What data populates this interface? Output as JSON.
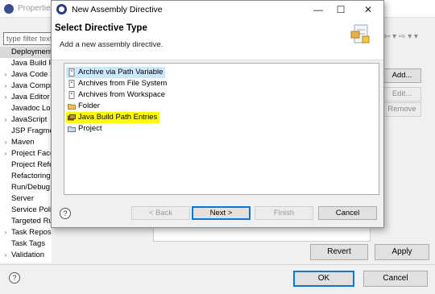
{
  "background_window": {
    "title": "Properties",
    "filter_placeholder": "type filter text",
    "nav_arrows": "⇦ ▾ ⇨ ▾ ▾",
    "tree": [
      {
        "label": "Deployment Assembly",
        "expander": "",
        "selected": true
      },
      {
        "label": "Java Build Path",
        "expander": "",
        "selected": false
      },
      {
        "label": "Java Code Style",
        "expander": "›",
        "selected": false
      },
      {
        "label": "Java Compiler",
        "expander": "›",
        "selected": false
      },
      {
        "label": "Java Editor",
        "expander": "›",
        "selected": false
      },
      {
        "label": "Javadoc Location",
        "expander": "",
        "selected": false
      },
      {
        "label": "JavaScript",
        "expander": "›",
        "selected": false
      },
      {
        "label": "JSP Fragment",
        "expander": "",
        "selected": false
      },
      {
        "label": "Maven",
        "expander": "›",
        "selected": false
      },
      {
        "label": "Project Facets",
        "expander": "›",
        "selected": false
      },
      {
        "label": "Project References",
        "expander": "",
        "selected": false
      },
      {
        "label": "Refactoring History",
        "expander": "",
        "selected": false
      },
      {
        "label": "Run/Debug Settings",
        "expander": "",
        "selected": false
      },
      {
        "label": "Server",
        "expander": "",
        "selected": false
      },
      {
        "label": "Service Policies",
        "expander": "",
        "selected": false
      },
      {
        "label": "Targeted Runtimes",
        "expander": "",
        "selected": false
      },
      {
        "label": "Task Repository",
        "expander": "›",
        "selected": false
      },
      {
        "label": "Task Tags",
        "expander": "",
        "selected": false
      },
      {
        "label": "Validation",
        "expander": "›",
        "selected": false
      }
    ],
    "side_buttons": {
      "add": "Add...",
      "edit": "Edit...",
      "remove": "Remove"
    },
    "revert_label": "Revert",
    "apply_label": "Apply",
    "ok_label": "OK",
    "cancel_label": "Cancel",
    "help_icon": "?"
  },
  "dialog": {
    "title": "New Assembly Directive",
    "heading": "Select Directive Type",
    "subtitle": "Add a new assembly directive.",
    "items": [
      {
        "label": "Archive via Path Variable",
        "icon": "archive-icon",
        "state": "selected"
      },
      {
        "label": "Archives from File System",
        "icon": "archive-icon",
        "state": "normal"
      },
      {
        "label": "Archives from Workspace",
        "icon": "archive-icon",
        "state": "normal"
      },
      {
        "label": "Folder",
        "icon": "folder-icon",
        "state": "normal"
      },
      {
        "label": "Java Build Path Entries",
        "icon": "library-icon",
        "state": "highlighted"
      },
      {
        "label": "Project",
        "icon": "project-icon",
        "state": "normal"
      }
    ],
    "buttons": {
      "back": "< Back",
      "next": "Next >",
      "finish": "Finish",
      "cancel": "Cancel"
    },
    "help_icon": "?",
    "window_controls": {
      "minimize": "—",
      "maximize": "☐",
      "close": "✕"
    }
  }
}
